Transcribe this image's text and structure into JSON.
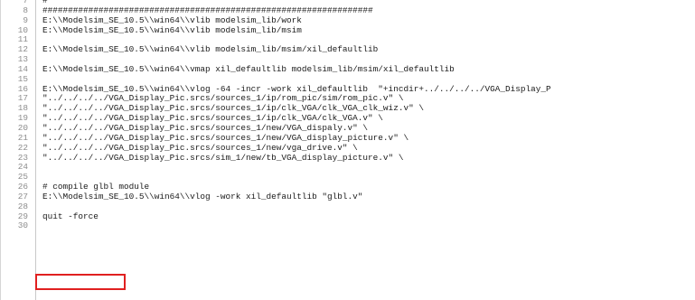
{
  "editor": {
    "lines": [
      {
        "num": "7",
        "text": "#"
      },
      {
        "num": "8",
        "text": "#################################################################"
      },
      {
        "num": "9",
        "text": "E:\\\\Modelsim_SE_10.5\\\\win64\\\\vlib modelsim_lib/work"
      },
      {
        "num": "10",
        "text": "E:\\\\Modelsim_SE_10.5\\\\win64\\\\vlib modelsim_lib/msim"
      },
      {
        "num": "11",
        "text": ""
      },
      {
        "num": "12",
        "text": "E:\\\\Modelsim_SE_10.5\\\\win64\\\\vlib modelsim_lib/msim/xil_defaultlib"
      },
      {
        "num": "13",
        "text": ""
      },
      {
        "num": "14",
        "text": "E:\\\\Modelsim_SE_10.5\\\\win64\\\\vmap xil_defaultlib modelsim_lib/msim/xil_defaultlib"
      },
      {
        "num": "15",
        "text": ""
      },
      {
        "num": "16",
        "text": "E:\\\\Modelsim_SE_10.5\\\\win64\\\\vlog -64 -incr -work xil_defaultlib  \"+incdir+../../../../VGA_Display_P"
      },
      {
        "num": "17",
        "text": "\"../../../../VGA_Display_Pic.srcs/sources_1/ip/rom_pic/sim/rom_pic.v\" \\"
      },
      {
        "num": "18",
        "text": "\"../../../../VGA_Display_Pic.srcs/sources_1/ip/clk_VGA/clk_VGA_clk_wiz.v\" \\"
      },
      {
        "num": "19",
        "text": "\"../../../../VGA_Display_Pic.srcs/sources_1/ip/clk_VGA/clk_VGA.v\" \\"
      },
      {
        "num": "20",
        "text": "\"../../../../VGA_Display_Pic.srcs/sources_1/new/VGA_dispaly.v\" \\"
      },
      {
        "num": "21",
        "text": "\"../../../../VGA_Display_Pic.srcs/sources_1/new/VGA_display_picture.v\" \\"
      },
      {
        "num": "22",
        "text": "\"../../../../VGA_Display_Pic.srcs/sources_1/new/vga_drive.v\" \\"
      },
      {
        "num": "23",
        "text": "\"../../../../VGA_Display_Pic.srcs/sim_1/new/tb_VGA_display_picture.v\" \\"
      },
      {
        "num": "24",
        "text": ""
      },
      {
        "num": "25",
        "text": ""
      },
      {
        "num": "26",
        "text": "# compile glbl module"
      },
      {
        "num": "27",
        "text": "E:\\\\Modelsim_SE_10.5\\\\win64\\\\vlog -work xil_defaultlib \"glbl.v\""
      },
      {
        "num": "28",
        "text": ""
      },
      {
        "num": "29",
        "text": "quit -force"
      },
      {
        "num": "30",
        "text": ""
      }
    ]
  },
  "colors": {
    "highlight_border": "#e02020",
    "line_number": "#8c8c8c",
    "code_text": "#1a1a1a"
  }
}
